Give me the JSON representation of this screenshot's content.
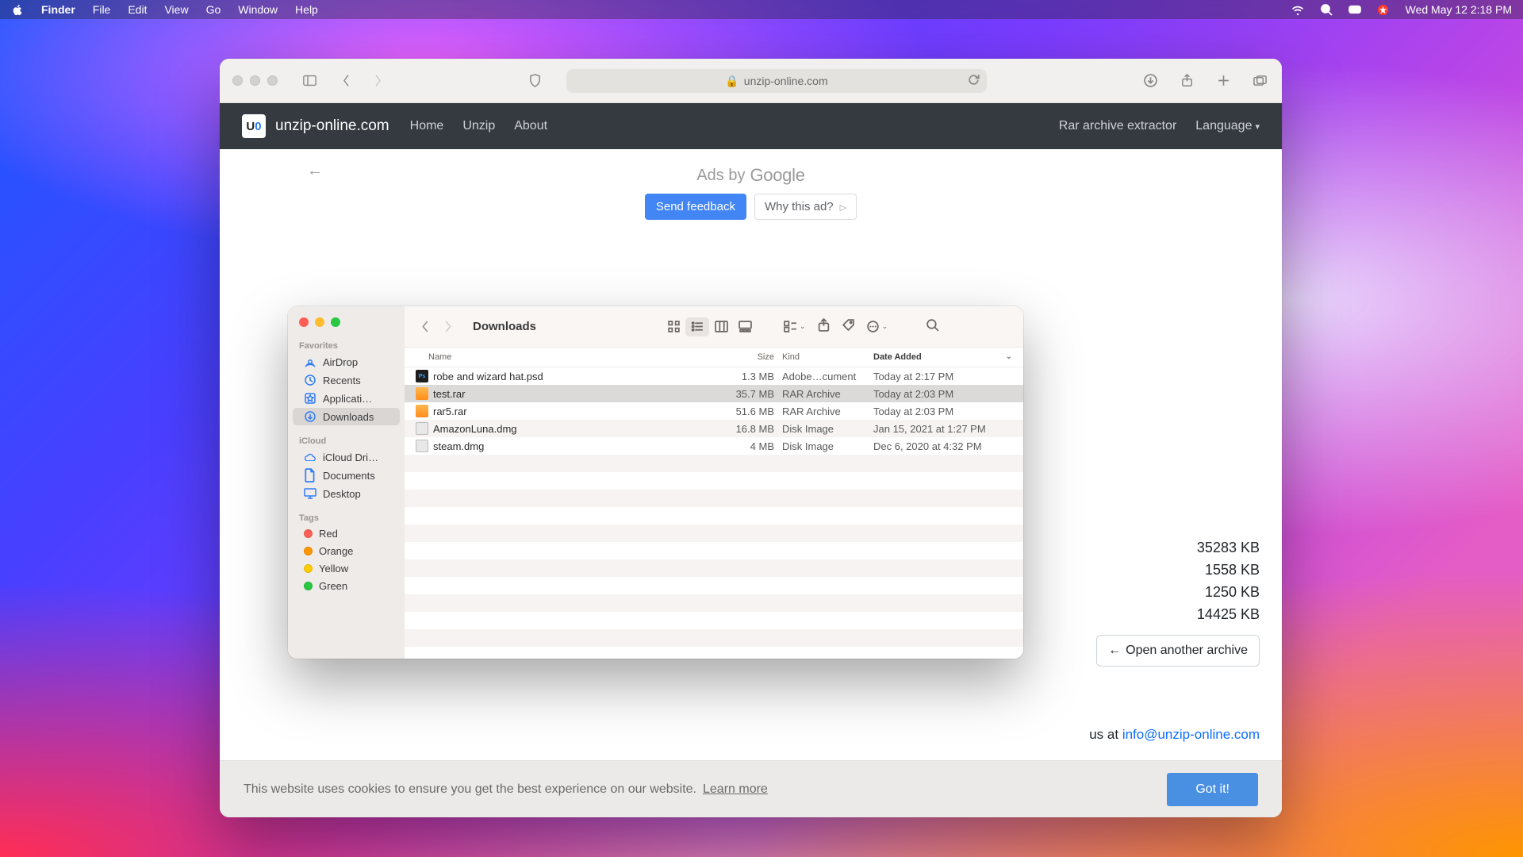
{
  "menubar": {
    "app": "Finder",
    "items": [
      "File",
      "Edit",
      "View",
      "Go",
      "Window",
      "Help"
    ],
    "clock": "Wed May 12  2:18 PM"
  },
  "safari": {
    "url_host": "unzip-online.com",
    "nav": {
      "brand": "unzip-online.com",
      "links": [
        "Home",
        "Unzip",
        "About"
      ],
      "right_link": "Rar archive extractor",
      "language_label": "Language"
    },
    "ad": {
      "label": "Ads by",
      "google": "Google",
      "send_feedback": "Send feedback",
      "why": "Why this ad?"
    },
    "sizes": [
      "35283 KB",
      "1558 KB",
      "1250 KB",
      "14425 KB"
    ],
    "open_another": "Open another archive",
    "contact_prefix": " us at ",
    "contact_email": "info@unzip-online.com",
    "cookie_text": "This website uses cookies to ensure you get the best experience on our website.",
    "cookie_learn": "Learn more",
    "cookie_btn": "Got it!"
  },
  "finder": {
    "title": "Downloads",
    "sidebar": {
      "sections": [
        {
          "label": "Favorites",
          "items": [
            {
              "icon": "airdrop",
              "label": "AirDrop"
            },
            {
              "icon": "recents",
              "label": "Recents"
            },
            {
              "icon": "apps",
              "label": "Applicati…"
            },
            {
              "icon": "downloads",
              "label": "Downloads",
              "selected": true
            }
          ]
        },
        {
          "label": "iCloud",
          "items": [
            {
              "icon": "icloud",
              "label": "iCloud Dri…"
            },
            {
              "icon": "doc",
              "label": "Documents"
            },
            {
              "icon": "desktop",
              "label": "Desktop"
            }
          ]
        },
        {
          "label": "Tags",
          "items": [
            {
              "tag": "#ff5f57",
              "label": "Red"
            },
            {
              "tag": "#ff9500",
              "label": "Orange"
            },
            {
              "tag": "#ffcc00",
              "label": "Yellow"
            },
            {
              "tag": "#28c840",
              "label": "Green"
            }
          ]
        }
      ]
    },
    "columns": {
      "name": "Name",
      "size": "Size",
      "kind": "Kind",
      "date": "Date Added"
    },
    "rows": [
      {
        "icon": "psd",
        "name": "robe and wizard hat.psd",
        "size": "1.3 MB",
        "kind": "Adobe…cument",
        "date": "Today at 2:17 PM"
      },
      {
        "icon": "rar",
        "name": "test.rar",
        "size": "35.7 MB",
        "kind": "RAR Archive",
        "date": "Today at 2:03 PM",
        "selected": true
      },
      {
        "icon": "rar",
        "name": "rar5.rar",
        "size": "51.6 MB",
        "kind": "RAR Archive",
        "date": "Today at 2:03 PM"
      },
      {
        "icon": "dmg",
        "name": "AmazonLuna.dmg",
        "size": "16.8 MB",
        "kind": "Disk Image",
        "date": "Jan 15, 2021 at 1:27 PM"
      },
      {
        "icon": "dmg",
        "name": "steam.dmg",
        "size": "4 MB",
        "kind": "Disk Image",
        "date": "Dec 6, 2020 at 4:32 PM"
      }
    ]
  }
}
